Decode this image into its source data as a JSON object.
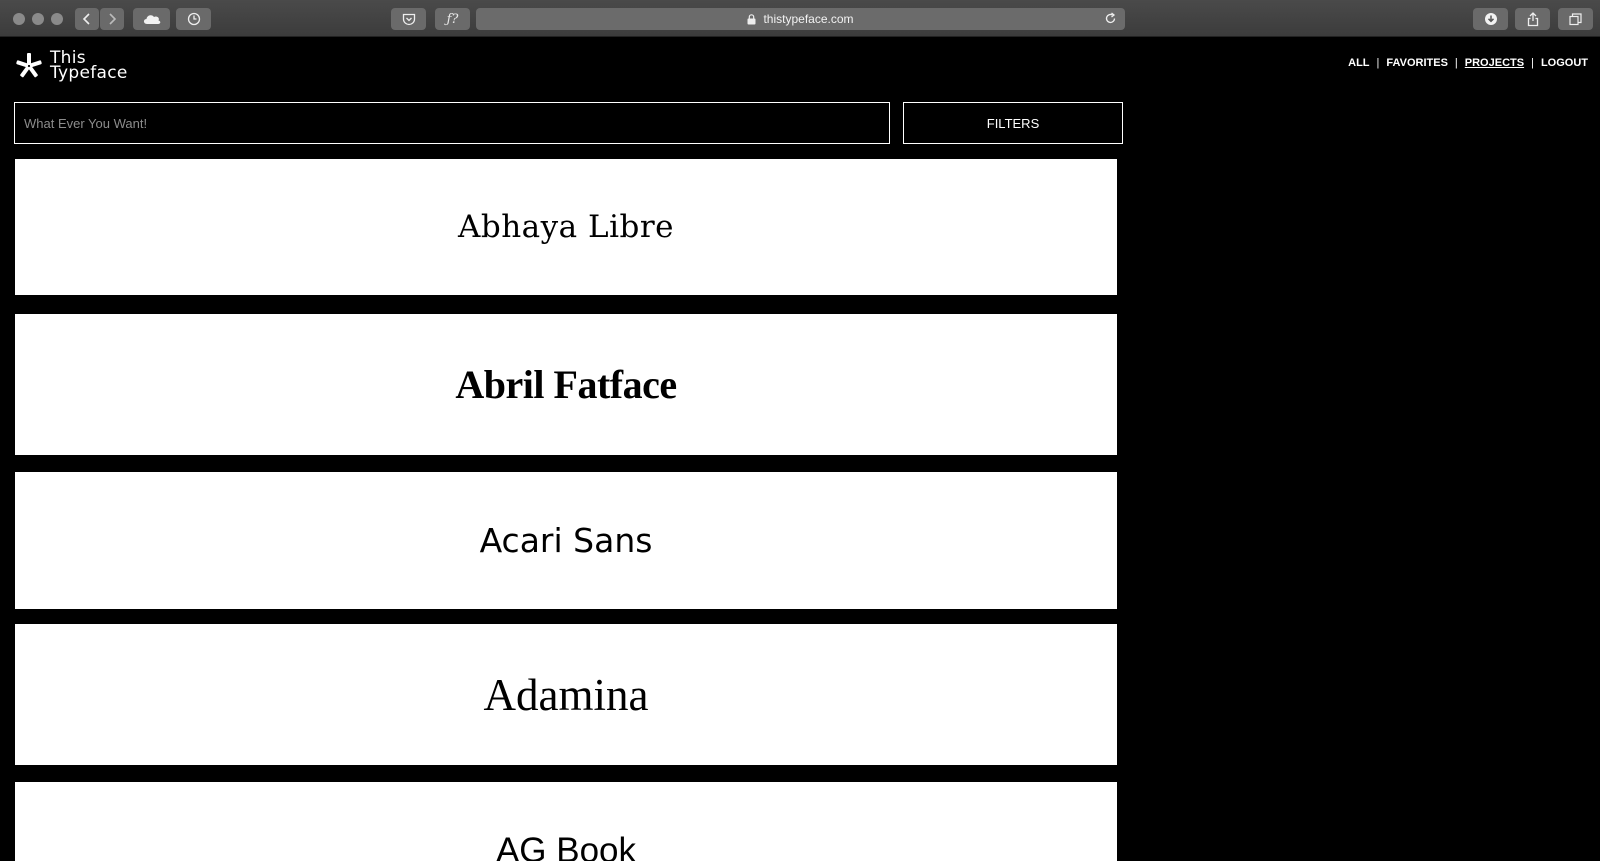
{
  "browser": {
    "url": "thistypeface.com",
    "icons": [
      "cloud-icon",
      "history-icon",
      "pocket-icon",
      "font-icon",
      "lock-icon",
      "reload-icon",
      "download-icon",
      "share-icon",
      "tabs-icon"
    ],
    "font_button_label": "ƒ?"
  },
  "header": {
    "logo_line1": "This",
    "logo_line2": "Typeface",
    "nav": [
      {
        "label": "ALL"
      },
      {
        "label": "FAVORITES"
      },
      {
        "label": "PROJECTS",
        "active": true
      },
      {
        "label": "LOGOUT"
      }
    ],
    "separator": "|"
  },
  "search": {
    "placeholder": "What Ever You Want!"
  },
  "filters": {
    "label": "FILTERS"
  },
  "fonts": [
    {
      "name": "Abhaya Libre"
    },
    {
      "name": "Abril Fatface"
    },
    {
      "name": "Acari Sans"
    },
    {
      "name": "Adamina"
    },
    {
      "name": "AG Book"
    }
  ],
  "colors": {
    "background": "#000000",
    "card": "#ffffff",
    "chrome": "#404040"
  }
}
